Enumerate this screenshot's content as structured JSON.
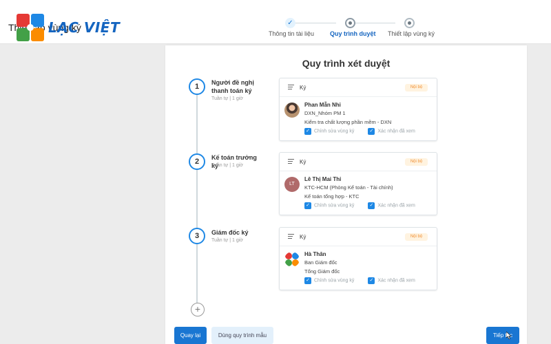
{
  "header": {
    "page_title": "Thiết lập vùng ký",
    "logo_text": "LẠC VIỆT",
    "steps": [
      {
        "label": "Thông tin tài liệu",
        "state": "done"
      },
      {
        "label": "Quy trình duyệt",
        "state": "active"
      },
      {
        "label": "Thiết lập vùng ký",
        "state": "todo"
      }
    ]
  },
  "main": {
    "title": "Quy trình xét duyệt",
    "add_symbol": "+",
    "steps": [
      {
        "number": "1",
        "name": "Người đề nghị thanh toán ký",
        "sub": "Tuần tự | 1 giờ",
        "card": {
          "type": "Ký",
          "badge": "Nội bộ",
          "person": "Phan Mẫn Nhi",
          "line1": "DXN_Nhóm PM 1",
          "line2": "Kiểm tra chất lượng phần mềm - DXN",
          "check1": "Chỉnh sửa vùng ký",
          "check2": "Xác nhận đã xem"
        }
      },
      {
        "number": "2",
        "name": "Kế toán trưởng ký",
        "sub": "Tuần tự | 1 giờ",
        "card": {
          "type": "Ký",
          "badge": "Nội bộ",
          "avatar_initials": "LT",
          "person": "Lê Thị Mai Thi",
          "line1": "KTC-HCM (Phòng Kế toán - Tài chính)",
          "line2": "Kế toán tổng hợp - KTC",
          "check1": "Chỉnh sửa vùng ký",
          "check2": "Xác nhận đã xem"
        }
      },
      {
        "number": "3",
        "name": "Giám đốc ký",
        "sub": "Tuần tự | 1 giờ",
        "card": {
          "type": "Ký",
          "badge": "Nội bộ",
          "person": "Hà Thân",
          "line1": "Ban Giám đốc",
          "line2": "Tổng Giám đốc",
          "check1": "Chỉnh sửa vùng ký",
          "check2": "Xác nhận đã xem"
        }
      }
    ]
  },
  "footer": {
    "back_label": "Quay lại",
    "template_label": "Dùng quy trình mẫu",
    "next_label": "Tiếp tục"
  },
  "colors": {
    "accent": "#1976d2",
    "badge_text": "#f08c2e",
    "badge_bg": "#fff3e0"
  },
  "icons": [
    "check-icon",
    "document-icon",
    "plus-icon",
    "checkbox-icon",
    "cursor-icon"
  ]
}
